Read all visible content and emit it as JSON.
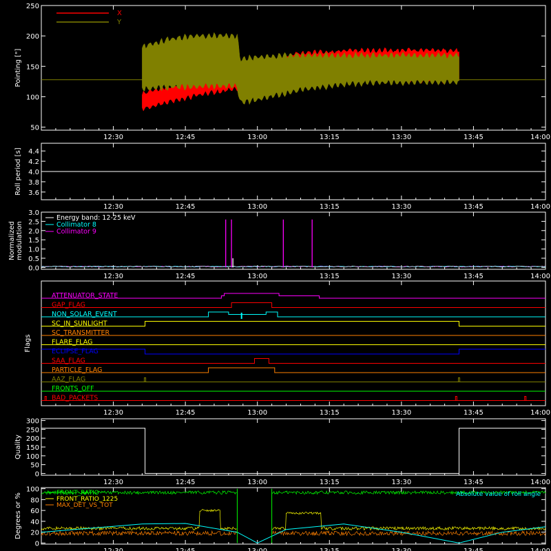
{
  "chart_data": [
    {
      "id": "pointing",
      "type": "line",
      "title": "",
      "xlabel": "",
      "ylabel": "Pointing [\"]",
      "ylim": [
        45,
        250
      ],
      "yticks": [
        50,
        100,
        150,
        200,
        250
      ],
      "legend_placement": "top-left",
      "grid": false,
      "reference_line": 128,
      "series": [
        {
          "name": "X",
          "color": "#ff0000",
          "band_low": [
            [
              12.6,
              80
            ],
            [
              12.7,
              92
            ],
            [
              12.8,
              103
            ],
            [
              12.9,
              112
            ],
            [
              12.93,
              113
            ],
            [
              12.94,
              116
            ],
            [
              13.05,
              122
            ],
            [
              13.15,
              124
            ],
            [
              13.3,
              126
            ],
            [
              13.4,
              126
            ],
            [
              13.7,
              125
            ]
          ],
          "band_high": [
            [
              12.6,
              105
            ],
            [
              12.7,
              118
            ],
            [
              12.8,
              130
            ],
            [
              12.9,
              134
            ],
            [
              12.93,
              135
            ],
            [
              12.94,
              155
            ],
            [
              13.05,
              162
            ],
            [
              13.15,
              172
            ],
            [
              13.3,
              175
            ],
            [
              13.4,
              176
            ],
            [
              13.7,
              176
            ]
          ]
        },
        {
          "name": "Y",
          "color": "#808000",
          "band_low": [
            [
              12.6,
              113
            ],
            [
              12.7,
              116
            ],
            [
              12.8,
              117
            ],
            [
              12.9,
              118
            ],
            [
              12.93,
              118
            ],
            [
              12.94,
              90
            ],
            [
              13.05,
              100
            ],
            [
              13.15,
              112
            ],
            [
              13.3,
              120
            ],
            [
              13.4,
              123
            ],
            [
              13.7,
              124
            ]
          ],
          "band_high": [
            [
              12.6,
              182
            ],
            [
              12.7,
              195
            ],
            [
              12.8,
              200
            ],
            [
              12.9,
              200
            ],
            [
              12.93,
              199
            ],
            [
              12.94,
              162
            ],
            [
              13.05,
              167
            ],
            [
              13.15,
              168
            ],
            [
              13.3,
              168
            ],
            [
              13.4,
              168
            ],
            [
              13.7,
              168
            ]
          ]
        }
      ]
    },
    {
      "id": "roll",
      "type": "line",
      "ylabel": "Roll period [s]",
      "ylim": [
        3.45,
        4.55
      ],
      "yticks": [
        "3.6",
        "3.8",
        "4.0",
        "4.2",
        "4.4"
      ],
      "series": [
        {
          "values": [
            [
              12.25,
              4.0
            ],
            [
              14.0,
              4.0
            ]
          ],
          "color": "#ffffff"
        }
      ]
    },
    {
      "id": "modulation",
      "type": "line",
      "ylabel": [
        "Normalized",
        "modulation"
      ],
      "ylim": [
        -0.1,
        3.0
      ],
      "yticks": [
        "0.0",
        "0.5",
        "1.0",
        "1.5",
        "2.0",
        "2.5",
        "3.0"
      ],
      "legend": [
        "Energy band: 12-25 keV",
        "Collimator 8",
        "Collimator 9"
      ],
      "legend_colors": [
        "#ffffff",
        "#00ffff",
        "#ff00ff"
      ],
      "spikes": [
        {
          "x": 12.89,
          "y": 2.6,
          "color": "#ff00ff"
        },
        {
          "x": 12.91,
          "y": 2.6,
          "color": "#ff00ff"
        },
        {
          "x": 13.09,
          "y": 2.6,
          "color": "#ff00ff"
        },
        {
          "x": 13.19,
          "y": 2.6,
          "color": "#ff00ff"
        },
        {
          "x": 12.915,
          "y": 0.5,
          "color": "#ffffff"
        }
      ]
    },
    {
      "id": "flags",
      "type": "line",
      "ylabel": "Flags",
      "flags": [
        {
          "name": "ATTENUATOR_STATE",
          "color": "#ff00ff",
          "high": [
            [
              12.885,
              13.075
            ]
          ],
          "mid": [
            [
              12.875,
              12.885
            ],
            [
              13.075,
              13.215
            ]
          ]
        },
        {
          "name": "GAP_FLAG",
          "color": "#ff0000",
          "high": [
            [
              12.91,
              13.05
            ]
          ]
        },
        {
          "name": "NON_SOLAR_EVENT",
          "color": "#00ffff",
          "high": [
            [
              12.83,
              12.9
            ],
            [
              13.03,
              13.07
            ]
          ],
          "mid": [
            [
              12.9,
              13.03
            ]
          ],
          "tick": 12.945
        },
        {
          "name": "SC_IN_SUNLIGHT",
          "color": "#ffff00",
          "high": [
            [
              12.61,
              13.7
            ]
          ]
        },
        {
          "name": "SC_TRANSMITTER",
          "color": "#ff8000",
          "high": []
        },
        {
          "name": "FLARE_FLAG",
          "color": "#ffff00",
          "high": []
        },
        {
          "name": "ECLIPSE_FLAG",
          "color": "#0000ff",
          "high": [
            [
              12.25,
              12.61
            ],
            [
              13.7,
              14.0
            ]
          ]
        },
        {
          "name": "SAA_FLAG",
          "color": "#ff0000",
          "high": [
            [
              12.99,
              13.04
            ]
          ]
        },
        {
          "name": "PARTICLE_FLAG",
          "color": "#ff8000",
          "high": [
            [
              12.83,
              13.06
            ]
          ]
        },
        {
          "name": "AAZ_FLAG",
          "color": "#808000",
          "pulses": [
            12.61,
            13.7
          ]
        },
        {
          "name": "FRONTS_OFF",
          "color": "#00ff00",
          "high": []
        },
        {
          "name": "BAD_PACKETS",
          "color": "#ff0000",
          "pulses": [
            12.265,
            13.69,
            13.93
          ]
        }
      ]
    },
    {
      "id": "quality",
      "type": "line",
      "ylabel": "Quality",
      "ylim": [
        -10,
        310
      ],
      "yticks": [
        0,
        50,
        100,
        150,
        200,
        250,
        300
      ],
      "series": [
        {
          "values": [
            [
              12.25,
              256
            ],
            [
              12.61,
              256
            ],
            [
              12.61,
              0
            ],
            [
              13.7,
              0
            ],
            [
              13.7,
              256
            ],
            [
              14.0,
              256
            ]
          ],
          "color": "#ffffff"
        }
      ]
    },
    {
      "id": "ratios",
      "type": "line",
      "ylabel": "Degrees or %",
      "ylim": [
        -2,
        102
      ],
      "yticks": [
        0,
        20,
        40,
        60,
        80,
        100
      ],
      "legend": [
        "FRONT_RATIO",
        "FRONT_RATIO_1225",
        "MAX_DET_VS_TOT"
      ],
      "legend_colors": [
        "#00ff00",
        "#ffff00",
        "#ff8000"
      ],
      "overlay_text": "Absolute value of roll angle",
      "series": [
        {
          "name": "FRONT_RATIO",
          "color": "#00ff00",
          "base": 93,
          "noise": 3,
          "gaps": [
            [
              12.93,
              13.05
            ]
          ]
        },
        {
          "name": "FRONT_RATIO_1225",
          "color": "#ffff00",
          "base": 27,
          "noise": 3,
          "bumps": [
            [
              12.8,
              12.87,
              60
            ],
            [
              13.1,
              13.22,
              55
            ]
          ],
          "gaps": [
            [
              12.93,
              13.05
            ]
          ]
        },
        {
          "name": "MAX_DET_VS_TOT",
          "color": "#ff8000",
          "base": 18,
          "noise": 4,
          "gaps": [
            [
              12.93,
              13.05
            ]
          ]
        },
        {
          "name": "roll_angle",
          "color": "#00ffff",
          "values": [
            [
              12.25,
              20
            ],
            [
              12.6,
              35
            ],
            [
              12.75,
              36
            ],
            [
              12.93,
              20
            ],
            [
              13.0,
              0
            ],
            [
              13.1,
              25
            ],
            [
              13.3,
              35
            ],
            [
              13.5,
              20
            ],
            [
              13.7,
              0
            ],
            [
              13.85,
              20
            ],
            [
              14.0,
              30
            ]
          ]
        }
      ]
    }
  ],
  "xaxis": {
    "xlim": [
      12.25,
      14.0
    ],
    "ticks": [
      12.5,
      12.75,
      13.0,
      13.25,
      13.5,
      13.75,
      14.0
    ],
    "ticklabels": [
      "12:30",
      "12:45",
      "13:00",
      "13:15",
      "13:30",
      "13:45",
      "14:00"
    ]
  }
}
